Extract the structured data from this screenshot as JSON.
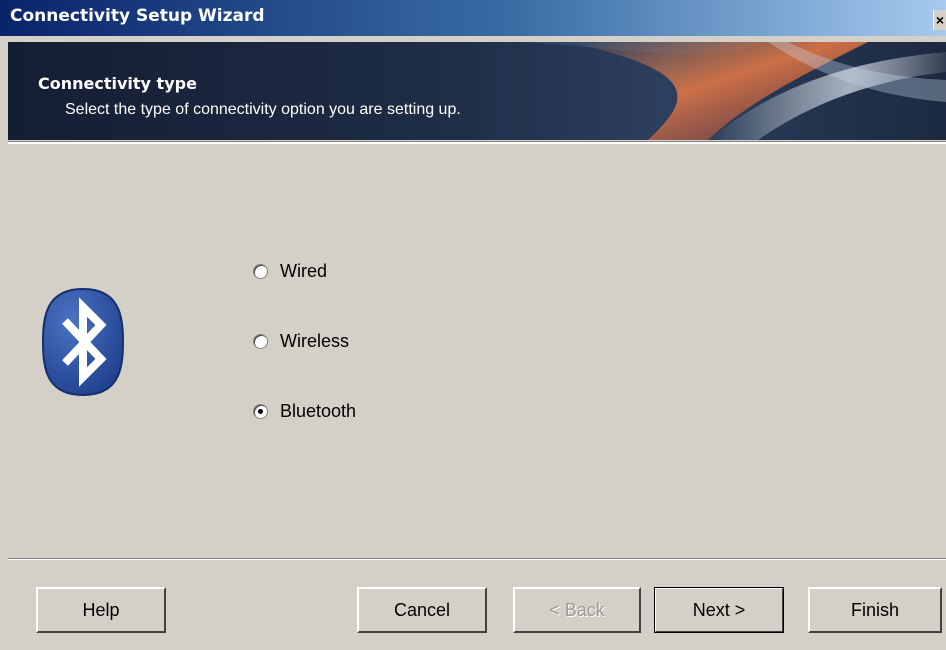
{
  "window": {
    "title": "Connectivity Setup Wizard",
    "close_label": "×"
  },
  "header": {
    "title": "Connectivity type",
    "subtitle": "Select the type of connectivity option you are setting up."
  },
  "icon": {
    "name": "bluetooth-icon",
    "color": "#2b4f9e"
  },
  "options": [
    {
      "label": "Wired",
      "selected": false
    },
    {
      "label": "Wireless",
      "selected": false
    },
    {
      "label": "Bluetooth",
      "selected": true
    }
  ],
  "buttons": {
    "help": "Help",
    "cancel": "Cancel",
    "back": "< Back",
    "next": "Next >",
    "finish": "Finish"
  },
  "colors": {
    "dialog_bg": "#d4d0c8",
    "titlebar_start": "#0a246a",
    "header_bg": "#1e2c45"
  }
}
